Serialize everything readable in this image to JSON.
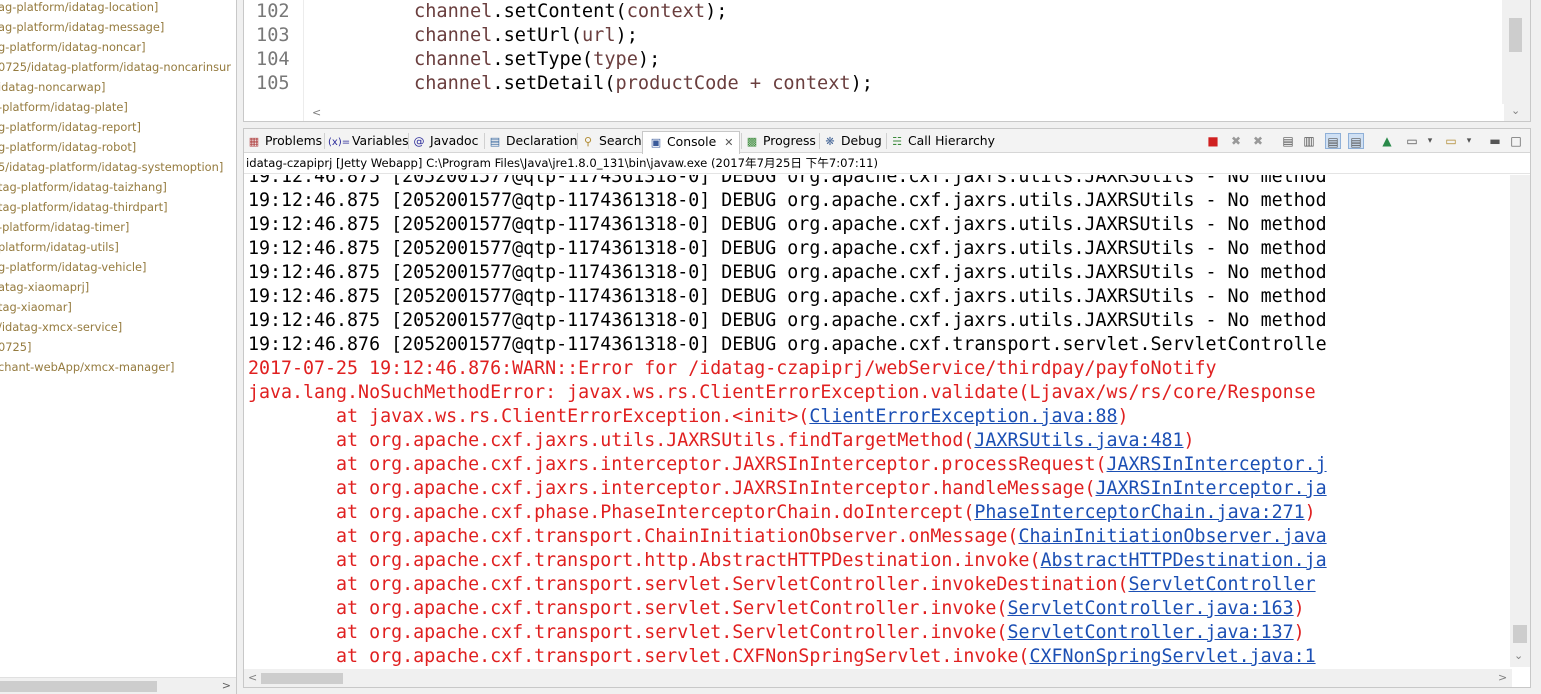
{
  "project_tree": {
    "items": [
      "ag-platform/idatag-location]",
      "ag-platform/idatag-message]",
      "g-platform/idatag-noncar]",
      "0725/idatag-platform/idatag-noncarinsur",
      "idatag-noncarwap]",
      "-platform/idatag-plate]",
      "g-platform/idatag-report]",
      "g-platform/idatag-robot]",
      "5/idatag-platform/idatag-systemoption]",
      "tag-platform/idatag-taizhang]",
      "tag-platform/idatag-thirdpart]",
      "-platform/idatag-timer]",
      "platform/idatag-utils]",
      "g-platform/idatag-vehicle]",
      "atag-xiaomaprj]",
      "tag-xiaomar]",
      "/idatag-xmcx-service]",
      "0725]",
      "chant-webApp/xmcx-manager]"
    ]
  },
  "editor": {
    "lines": [
      {
        "num": "102",
        "obj": "channel",
        "call": ".setContent(",
        "arg": "context",
        "end": ");"
      },
      {
        "num": "103",
        "obj": "channel",
        "call": ".setUrl(",
        "arg": "url",
        "end": ");"
      },
      {
        "num": "104",
        "obj": "channel",
        "call": ".setType(",
        "arg": "type",
        "end": ");"
      },
      {
        "num": "105",
        "obj": "channel",
        "call": ".setDetail(",
        "arg": "productCode + context",
        "end": ");"
      }
    ]
  },
  "tabs": {
    "problems": "Problems",
    "variables": "Variables",
    "javadoc": "Javadoc",
    "declaration": "Declaration",
    "search": "Search",
    "console": "Console",
    "progress": "Progress",
    "debug": "Debug",
    "call_hierarchy": "Call Hierarchy"
  },
  "console": {
    "process_label": "idatag-czapiprj [Jetty Webapp] C:\\Program Files\\Java\\jre1.8.0_131\\bin\\javaw.exe (2017年7月25日 下午7:07:11)",
    "debug_lines": [
      "19:12:46.875 [2052001577@qtp-1174361318-0] DEBUG org.apache.cxf.jaxrs.utils.JAXRSUtils - No method",
      "19:12:46.875 [2052001577@qtp-1174361318-0] DEBUG org.apache.cxf.jaxrs.utils.JAXRSUtils - No method",
      "19:12:46.875 [2052001577@qtp-1174361318-0] DEBUG org.apache.cxf.jaxrs.utils.JAXRSUtils - No method",
      "19:12:46.875 [2052001577@qtp-1174361318-0] DEBUG org.apache.cxf.jaxrs.utils.JAXRSUtils - No method",
      "19:12:46.875 [2052001577@qtp-1174361318-0] DEBUG org.apache.cxf.jaxrs.utils.JAXRSUtils - No method",
      "19:12:46.875 [2052001577@qtp-1174361318-0] DEBUG org.apache.cxf.jaxrs.utils.JAXRSUtils - No method",
      "19:12:46.875 [2052001577@qtp-1174361318-0] DEBUG org.apache.cxf.jaxrs.utils.JAXRSUtils - No method",
      "19:12:46.876 [2052001577@qtp-1174361318-0] DEBUG org.apache.cxf.transport.servlet.ServletControlle"
    ],
    "error_header": "2017-07-25 19:12:46.876:WARN::Error for /idatag-czapiprj/webService/thirdpay/payfoNotify",
    "exception": "java.lang.NoSuchMethodError: javax.ws.rs.ClientErrorException.validate(Ljavax/ws/rs/core/Response",
    "stack": [
      {
        "text": "        at javax.ws.rs.ClientErrorException.<init>(",
        "link": "ClientErrorException.java:88",
        "end": ")"
      },
      {
        "text": "        at org.apache.cxf.jaxrs.utils.JAXRSUtils.findTargetMethod(",
        "link": "JAXRSUtils.java:481",
        "end": ")"
      },
      {
        "text": "        at org.apache.cxf.jaxrs.interceptor.JAXRSInInterceptor.processRequest(",
        "link": "JAXRSInInterceptor.j",
        "end": ""
      },
      {
        "text": "        at org.apache.cxf.jaxrs.interceptor.JAXRSInInterceptor.handleMessage(",
        "link": "JAXRSInInterceptor.ja",
        "end": ""
      },
      {
        "text": "        at org.apache.cxf.phase.PhaseInterceptorChain.doIntercept(",
        "link": "PhaseInterceptorChain.java:271",
        "end": ")"
      },
      {
        "text": "        at org.apache.cxf.transport.ChainInitiationObserver.onMessage(",
        "link": "ChainInitiationObserver.java",
        "end": ""
      },
      {
        "text": "        at org.apache.cxf.transport.http.AbstractHTTPDestination.invoke(",
        "link": "AbstractHTTPDestination.ja",
        "end": ""
      },
      {
        "text": "        at org.apache.cxf.transport.servlet.ServletController.invokeDestination(",
        "link": "ServletController",
        "end": ""
      },
      {
        "text": "        at org.apache.cxf.transport.servlet.ServletController.invoke(",
        "link": "ServletController.java:163",
        "end": ")"
      },
      {
        "text": "        at org.apache.cxf.transport.servlet.ServletController.invoke(",
        "link": "ServletController.java:137",
        "end": ")"
      },
      {
        "text": "        at org.apache.cxf.transport.servlet.CXFNonSpringServlet.invoke(",
        "link": "CXFNonSpringServlet.java:1",
        "end": ""
      }
    ]
  },
  "colors": {
    "error_text": "#e02020",
    "link_text": "#1b4fb4",
    "tree_text": "#957b3f",
    "variable_text": "#6a3e3e"
  }
}
